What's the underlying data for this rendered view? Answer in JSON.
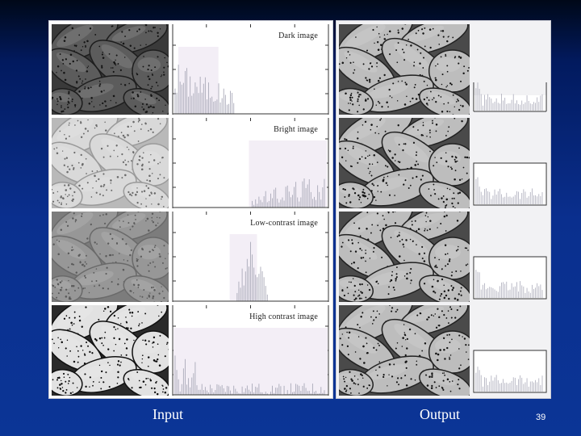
{
  "captions": {
    "input": "Input",
    "output": "Output"
  },
  "page_number": "39",
  "rows": [
    {
      "label": "Dark image",
      "input_tone": {
        "bg": "#3a3a3a",
        "bean": "#5c5c5c",
        "edge": "#1e1e1e",
        "dots": "#141414"
      },
      "histogram": "dark"
    },
    {
      "label": "Bright image",
      "input_tone": {
        "bg": "#b9b9b9",
        "bean": "#d9d9d9",
        "edge": "#9a9a9a",
        "dots": "#6a6a6a"
      },
      "histogram": "bright"
    },
    {
      "label": "Low-contrast image",
      "input_tone": {
        "bg": "#7c7c7c",
        "bean": "#979797",
        "edge": "#6a6a6a",
        "dots": "#5a5a5a"
      },
      "histogram": "low"
    },
    {
      "label": "High contrast image",
      "input_tone": {
        "bg": "#2a2a2a",
        "bean": "#e2e2e2",
        "edge": "#111111",
        "dots": "#0a0a0a"
      },
      "histogram": "high"
    }
  ],
  "output_tone": {
    "bg": "#4a4a4a",
    "bean": "#bdbdbd",
    "edge": "#222222",
    "dots": "#121212"
  },
  "colors": {
    "hist_bars": "#a9a9b8",
    "hist_band": "#f3eef6",
    "axis": "#333333"
  }
}
